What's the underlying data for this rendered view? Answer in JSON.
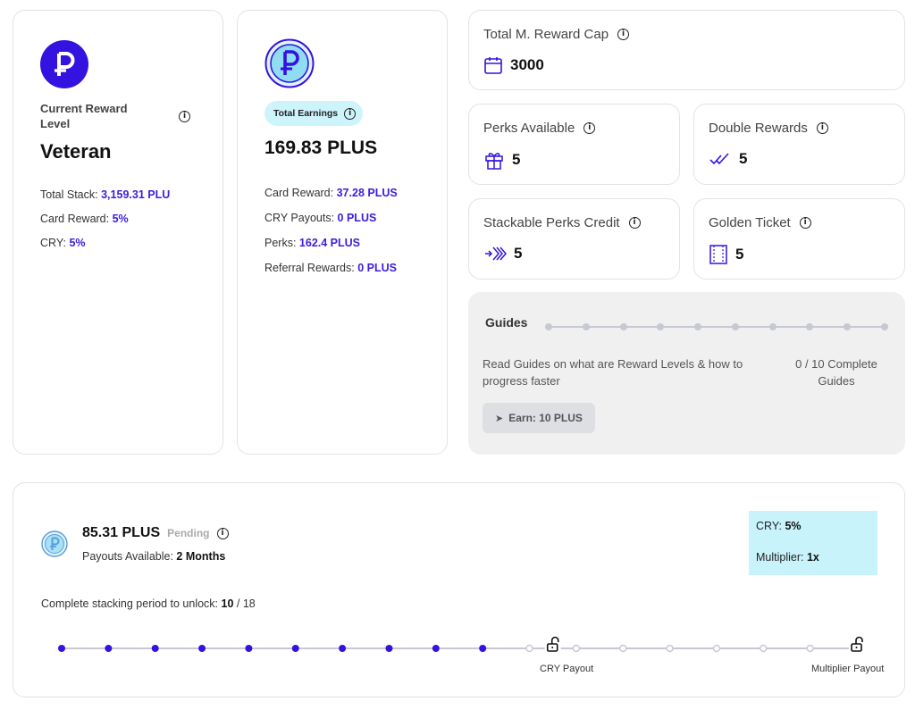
{
  "level_card": {
    "label": "Current Reward Level",
    "value": "Veteran",
    "total_stack_label": "Total Stack:",
    "total_stack_value": "3,159.31 PLU",
    "card_reward_label": "Card Reward:",
    "card_reward_value": "5%",
    "cry_label": "CRY:",
    "cry_value": "5%"
  },
  "earnings_card": {
    "badge": "Total Earnings",
    "value": "169.83 PLUS",
    "card_reward_label": "Card Reward:",
    "card_reward_value": "37.28 PLUS",
    "cry_payouts_label": "CRY Payouts:",
    "cry_payouts_value": "0 PLUS",
    "perks_label": "Perks:",
    "perks_value": "162.4 PLUS",
    "referral_label": "Referral Rewards:",
    "referral_value": "0 PLUS"
  },
  "reward_cap": {
    "title": "Total M. Reward Cap",
    "value": "3000",
    "icon": "calendar-icon"
  },
  "perks": {
    "title": "Perks Available",
    "value": "5",
    "icon": "gift-icon"
  },
  "double": {
    "title": "Double Rewards",
    "value": "5",
    "icon": "double-check-icon"
  },
  "stackable": {
    "title": "Stackable Perks Credit",
    "value": "5",
    "icon": "stack-arrows-icon"
  },
  "golden": {
    "title": "Golden Ticket",
    "value": "5",
    "icon": "ticket-icon"
  },
  "guides": {
    "title": "Guides",
    "description": "Read Guides on what are Reward Levels & how to progress faster",
    "progress": "0 / 10 Complete Guides",
    "completed": 0,
    "total": 10,
    "button": "Earn: 10 PLUS"
  },
  "payout": {
    "amount": "85.31 PLUS",
    "status": "Pending",
    "available_label": "Payouts Available:",
    "available_value": "2 Months",
    "cry_label": "CRY:",
    "cry_value": "5%",
    "multiplier_label": "Multiplier:",
    "multiplier_value": "1x",
    "stack_label": "Complete stacking period to unlock:",
    "stack_done": "10",
    "stack_total": "/ 18",
    "completed_steps": 10,
    "total_steps": 18,
    "milestones": [
      "CRY Payout",
      "Multiplier Payout"
    ]
  },
  "colors": {
    "accent": "#3412e0",
    "highlight": "#c8f3fb",
    "track": "#c6c8d4"
  }
}
